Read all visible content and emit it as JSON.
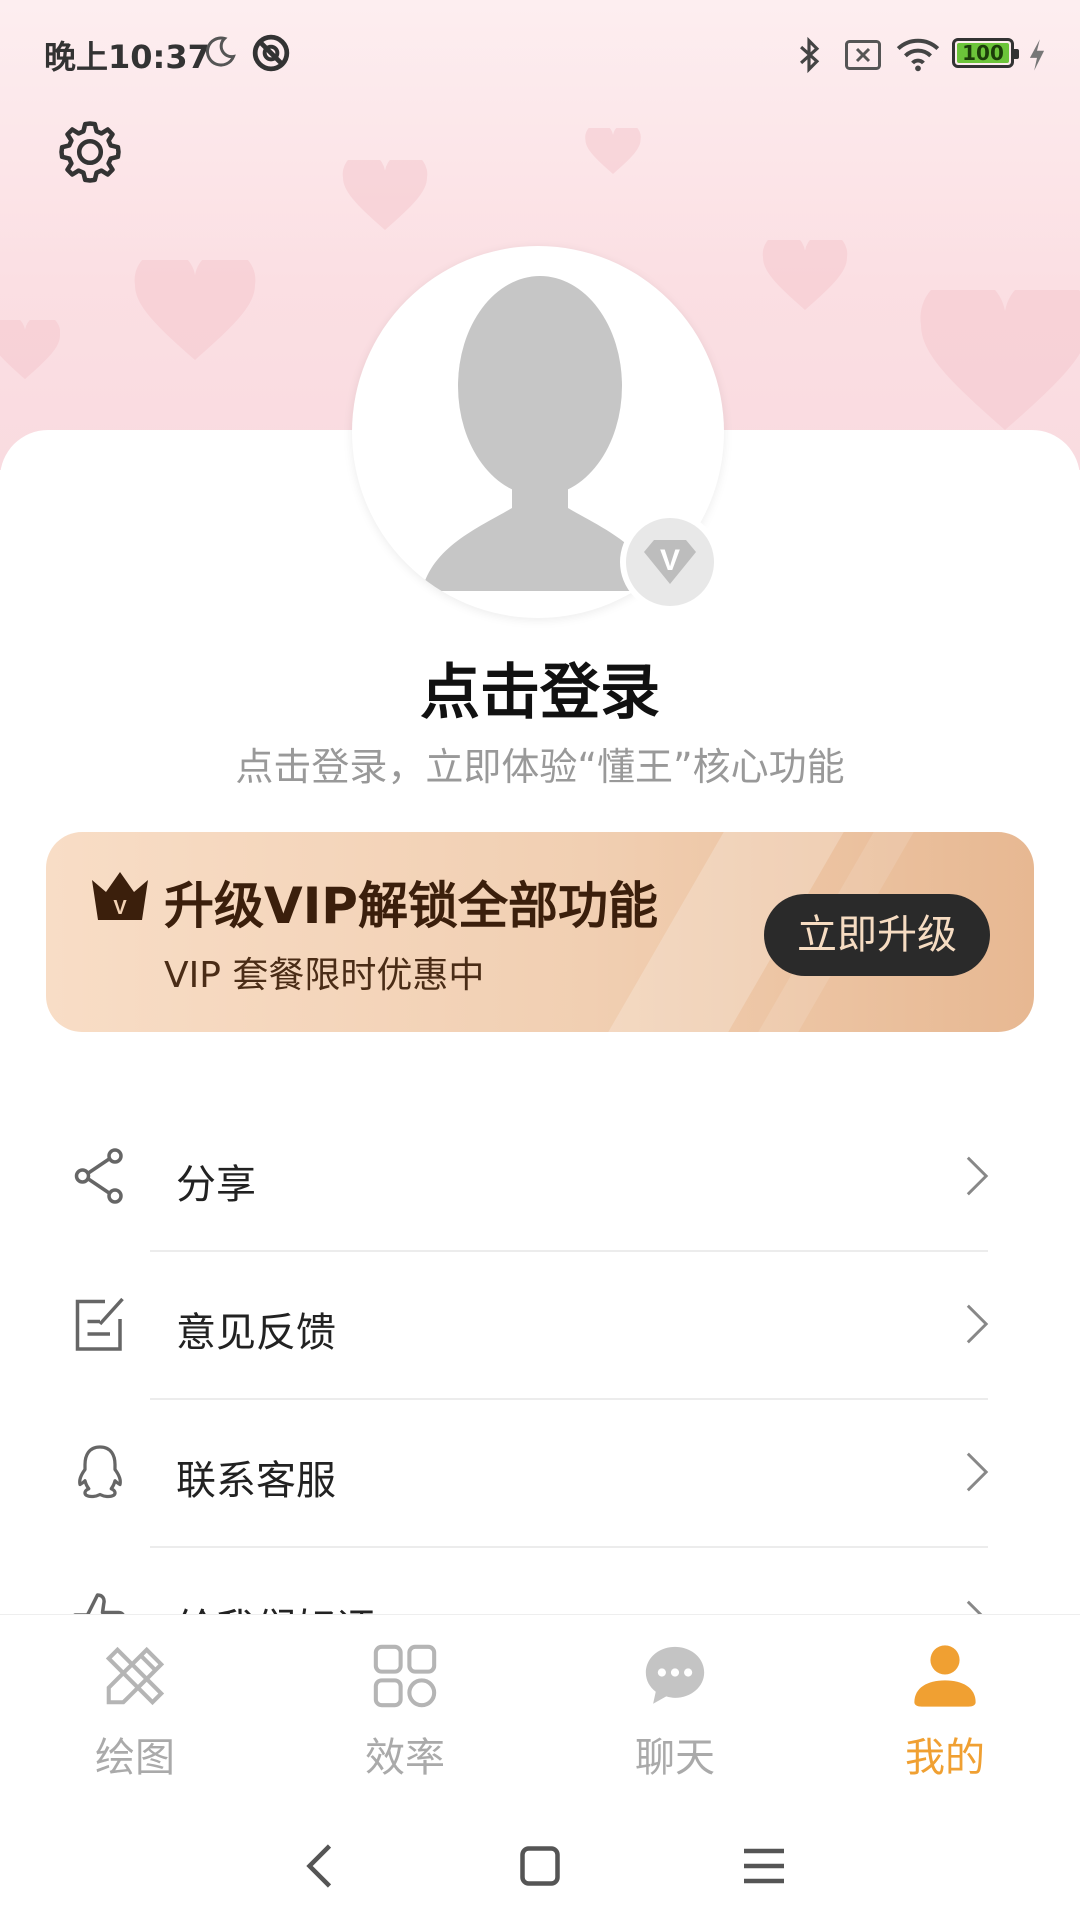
{
  "status_bar": {
    "time": "晚上10:37",
    "battery": "100",
    "icons": [
      "moon-icon",
      "do-not-disturb-icon",
      "bluetooth-icon",
      "sim-off-icon",
      "wifi-icon",
      "battery-icon",
      "charging-icon"
    ]
  },
  "header": {
    "settings_icon": "gear-icon"
  },
  "profile": {
    "login_title": "点击登录",
    "login_subtitle": "点击登录，立即体验“懂王”核心功能",
    "badge_letter": "V"
  },
  "vip_banner": {
    "title": "升级VIP解锁全部功能",
    "subtitle": "VIP 套餐限时优惠中",
    "button_label": "立即升级",
    "crown_letter": "V"
  },
  "menu": {
    "items": [
      {
        "label": "分享",
        "icon": "share-icon"
      },
      {
        "label": "意见反馈",
        "icon": "feedback-icon"
      },
      {
        "label": "联系客服",
        "icon": "qq-icon"
      },
      {
        "label": "给我们好评",
        "icon": "thumbs-up-icon"
      }
    ]
  },
  "tabbar": {
    "tabs": [
      {
        "label": "绘图",
        "icon": "pencil-ruler-icon"
      },
      {
        "label": "效率",
        "icon": "grid-icon"
      },
      {
        "label": "聊天",
        "icon": "chat-icon"
      },
      {
        "label": "我的",
        "icon": "person-icon"
      }
    ],
    "active_index": 3,
    "active_color": "#f0a032",
    "inactive_color": "#aaaaaa"
  },
  "colors": {
    "banner_start": "#f8ddc6",
    "banner_end": "#e7b892",
    "upgrade_button_bg": "#2a2a2a"
  }
}
